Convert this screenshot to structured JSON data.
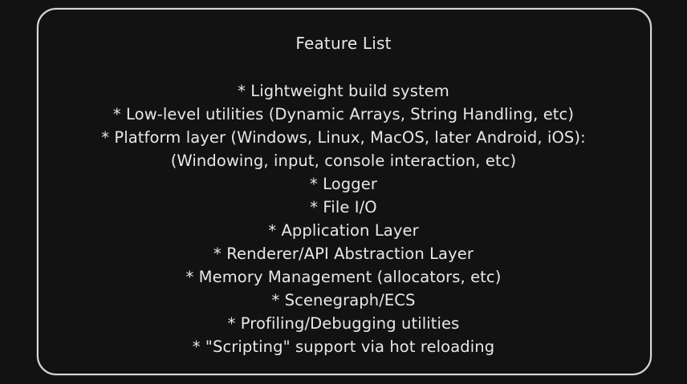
{
  "card": {
    "title": "Feature List",
    "items": [
      "* Lightweight build system",
      "* Low-level utilities (Dynamic Arrays, String Handling, etc)",
      "* Platform layer (Windows, Linux, MacOS, later Android, iOS):",
      "(Windowing, input, console interaction, etc)",
      "* Logger",
      "* File I/O",
      "* Application Layer",
      "* Renderer/API Abstraction Layer",
      "* Memory Management (allocators, etc)",
      "* Scenegraph/ECS",
      "* Profiling/Debugging utilities",
      "* \"Scripting\" support via hot reloading"
    ]
  },
  "colors": {
    "background": "#121212",
    "border": "#d9d9d9",
    "text": "#e8e8e8"
  }
}
